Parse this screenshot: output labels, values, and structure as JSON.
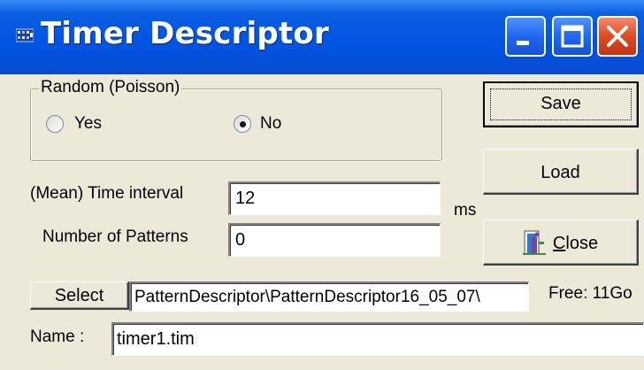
{
  "window": {
    "title": "Timer Descriptor",
    "icons": {
      "app": "app-icon",
      "minimize": "minimize-icon",
      "maximize": "maximize-icon",
      "close": "close-x-icon"
    }
  },
  "random_group": {
    "legend": "Random (Poisson)",
    "yes_label": "Yes",
    "no_label": "No",
    "selected": "No"
  },
  "fields": {
    "interval_label": "(Mean) Time interval",
    "interval_value": "12",
    "interval_unit": "ms",
    "patterns_label": "Number of Patterns",
    "patterns_value": "0",
    "path_value": "PatternDescriptor\\PatternDescriptor16_05_07\\",
    "free_text": "Free: 11Go",
    "name_label": "Name :",
    "name_value": "timer1.tim"
  },
  "buttons": {
    "save": "Save",
    "load": "Load",
    "close_prefix": "C",
    "close_rest": "lose",
    "select": "Select"
  },
  "colors": {
    "titlebar": "#0054e3",
    "window_bg": "#ece9d8",
    "close_button": "#e04a25"
  }
}
